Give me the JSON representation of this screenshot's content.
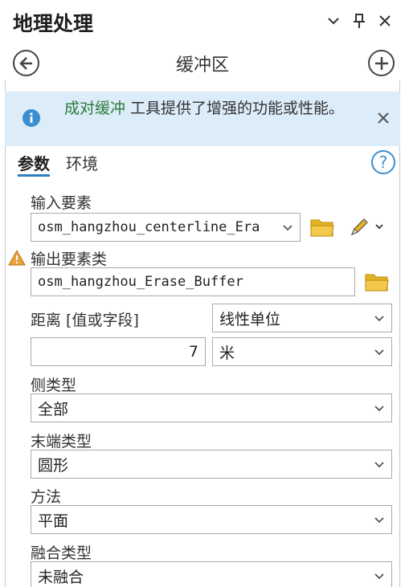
{
  "pane": {
    "title": "地理处理"
  },
  "tool": {
    "title": "缓冲区"
  },
  "banner": {
    "link_text": "成对缓冲",
    "text_rest": " 工具提供了增强的功能或性能。"
  },
  "tabs": [
    {
      "label": "参数"
    },
    {
      "label": "环境"
    }
  ],
  "params": {
    "input_features": {
      "label": "输入要素",
      "value": "osm_hangzhou_centerline_Era"
    },
    "output_features": {
      "label": "输出要素类",
      "value": "osm_hangzhou_Erase_Buffer"
    },
    "distance": {
      "label": "距离 [值或字段]",
      "mode": "线性单位",
      "value": "7",
      "unit": "米"
    },
    "side_type": {
      "label": "侧类型",
      "value": "全部"
    },
    "end_type": {
      "label": "末端类型",
      "value": "圆形"
    },
    "method": {
      "label": "方法",
      "value": "平面"
    },
    "dissolve_type": {
      "label": "融合类型",
      "value": "未融合"
    }
  },
  "colors": {
    "accent": "#2e7fbf",
    "banner_bg": "#dcecf9",
    "link_green": "#2d7a3a",
    "warning": "#e8a33c",
    "folder": "#e6b422"
  },
  "icons": [
    "chevron-down-icon",
    "pin-icon",
    "close-icon",
    "back-arrow-icon",
    "add-icon",
    "info-icon",
    "help-icon",
    "folder-icon",
    "pencil-icon",
    "warning-icon"
  ]
}
